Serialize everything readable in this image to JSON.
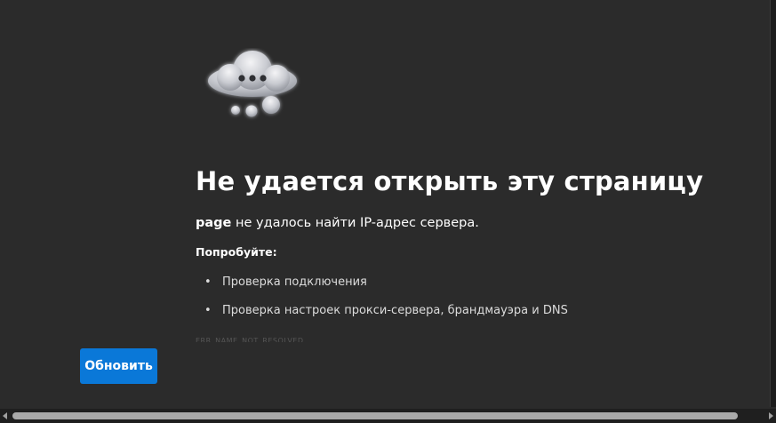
{
  "error": {
    "title": "Не удается открыть эту страницу",
    "host": "page",
    "message": " не удалось найти IP-адрес сервера.",
    "try_label": "Попробуйте:",
    "suggestions": [
      "Проверка подключения",
      "Проверка настроек прокси-сервера, брандмауэра и DNS"
    ],
    "error_code": "ERR_NAME_NOT_RESOLVED"
  },
  "actions": {
    "refresh_label": "Обновить"
  },
  "icons": {
    "cloud": "cloud-error-icon"
  },
  "colors": {
    "background": "#2b2b2b",
    "accent": "#0a78d8"
  }
}
